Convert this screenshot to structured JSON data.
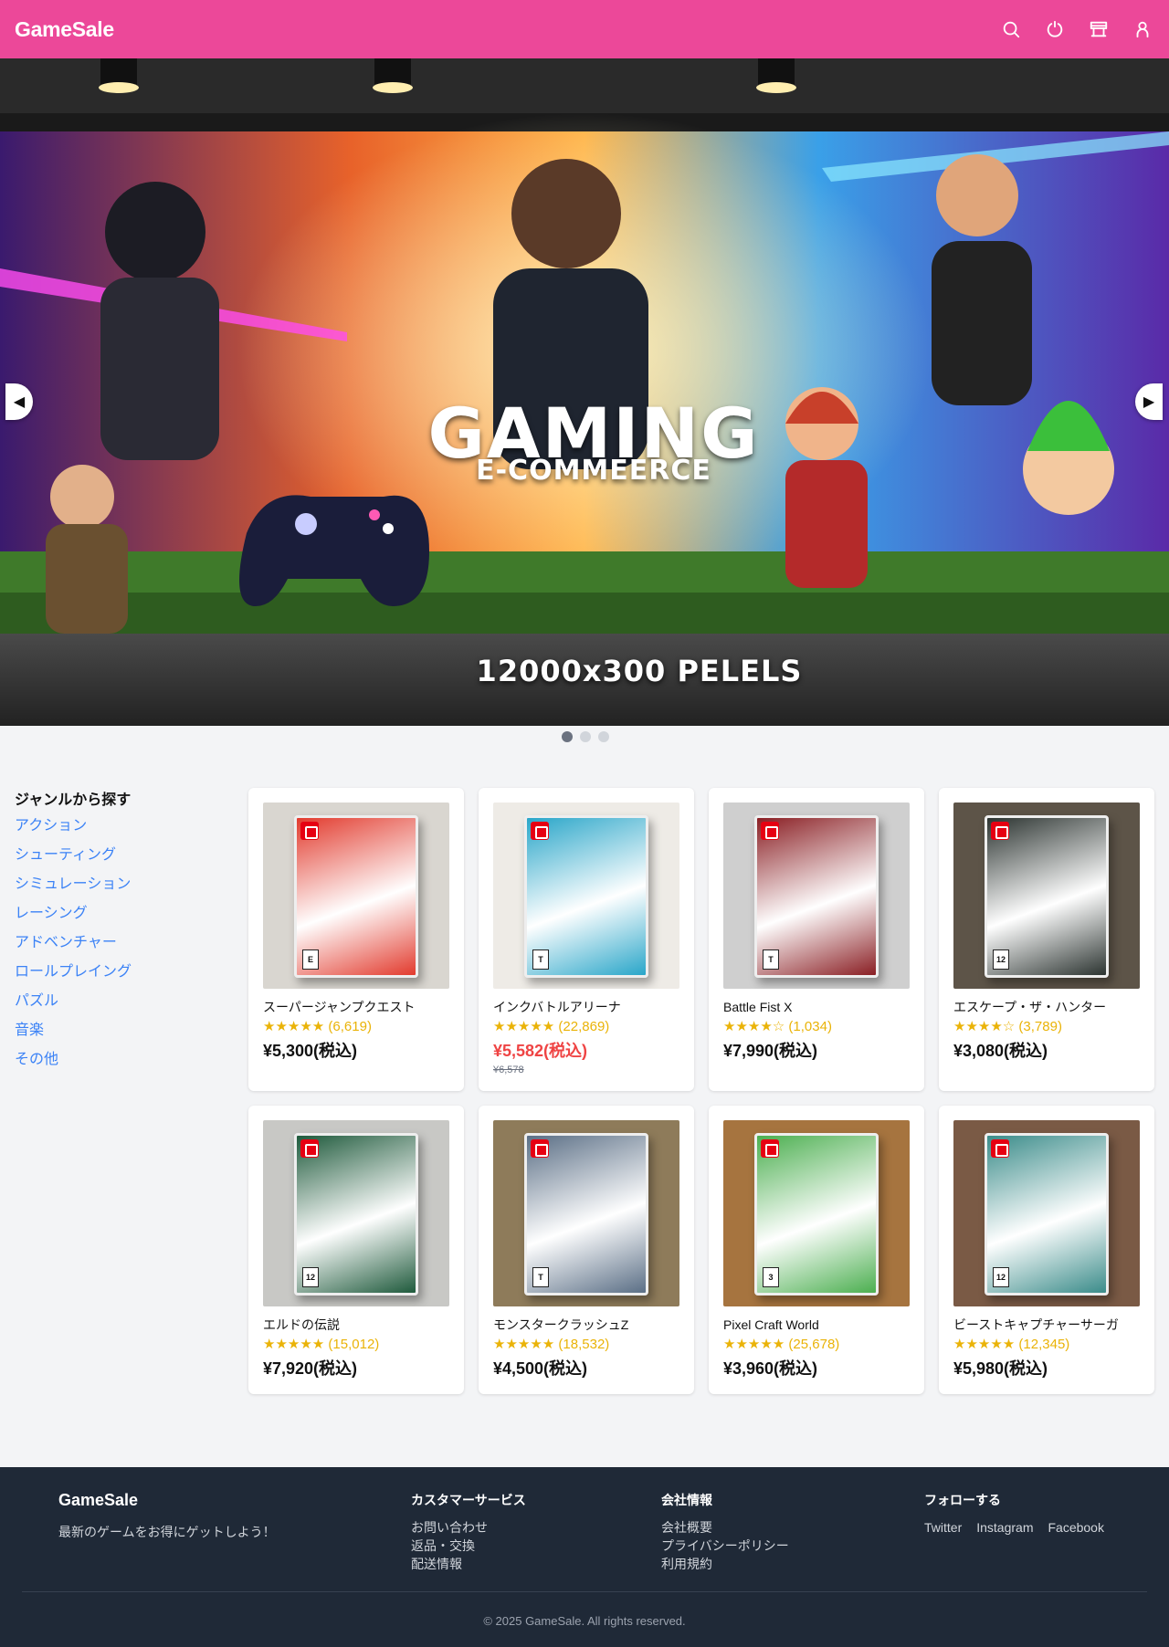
{
  "header": {
    "logo": "GameSale",
    "icons": [
      "search-icon",
      "power-icon",
      "store-icon",
      "user-icon"
    ]
  },
  "hero": {
    "title": "GAMING",
    "subtitle": "E-COMMEERCE",
    "caption": "12000x300 PELELS",
    "prev_label": "◀",
    "next_label": "▶",
    "slides": 3,
    "active_slide": 1
  },
  "sidebar": {
    "title": "ジャンルから探す",
    "genres": [
      "アクション",
      "シューティング",
      "シミュレーション",
      "レーシング",
      "アドベンチャー",
      "ロールプレイング",
      "パズル",
      "音楽",
      "その他"
    ]
  },
  "products": [
    {
      "name": "スーパージャンプクエスト",
      "stars": "★★★★★",
      "reviews": "(6,619)",
      "price": "¥5,300(税込)",
      "old_price": "",
      "bg": "#d9d6d0",
      "art": "#e23b2e",
      "rating_badge": "E"
    },
    {
      "name": "インクバトルアリーナ",
      "stars": "★★★★★",
      "reviews": "(22,869)",
      "price": "¥5,582(税込)",
      "old_price": "¥6,578",
      "bg": "#eeebe6",
      "art": "#2aa6c9",
      "rating_badge": "T"
    },
    {
      "name": "Battle Fist X",
      "stars": "★★★★☆",
      "reviews": "(1,034)",
      "price": "¥7,990(税込)",
      "old_price": "",
      "bg": "#cfcfcf",
      "art": "#8a1f24",
      "rating_badge": "T"
    },
    {
      "name": "エスケープ・ザ・ハンター",
      "stars": "★★★★☆",
      "reviews": "(3,789)",
      "price": "¥3,080(税込)",
      "old_price": "",
      "bg": "#5d5448",
      "art": "#2c3431",
      "rating_badge": "12"
    },
    {
      "name": "エルドの伝説",
      "stars": "★★★★★",
      "reviews": "(15,012)",
      "price": "¥7,920(税込)",
      "old_price": "",
      "bg": "#c8c8c5",
      "art": "#1f5a3c",
      "rating_badge": "12"
    },
    {
      "name": "モンスタークラッシュZ",
      "stars": "★★★★★",
      "reviews": "(18,532)",
      "price": "¥4,500(税込)",
      "old_price": "",
      "bg": "#8e7b5a",
      "art": "#5b6f86",
      "rating_badge": "T"
    },
    {
      "name": "Pixel Craft World",
      "stars": "★★★★★",
      "reviews": "(25,678)",
      "price": "¥3,960(税込)",
      "old_price": "",
      "bg": "#a6743f",
      "art": "#4caf50",
      "rating_badge": "3"
    },
    {
      "name": "ビーストキャプチャーサーガ",
      "stars": "★★★★★",
      "reviews": "(12,345)",
      "price": "¥5,980(税込)",
      "old_price": "",
      "bg": "#7a5a45",
      "art": "#3b8c8a",
      "rating_badge": "12"
    }
  ],
  "footer": {
    "brand": "GameSale",
    "tagline": "最新のゲームをお得にゲットしよう！",
    "customer_service": {
      "title": "カスタマーサービス",
      "links": [
        "お問い合わせ",
        "返品・交換",
        "配送情報"
      ]
    },
    "company": {
      "title": "会社情報",
      "links": [
        "会社概要",
        "プライバシーポリシー",
        "利用規約"
      ]
    },
    "follow": {
      "title": "フォローする",
      "links": [
        "Twitter",
        "Instagram",
        "Facebook"
      ]
    },
    "copyright": "© 2025 GameSale. All rights reserved."
  },
  "colors": {
    "brand": "#ec4899",
    "link": "#3b82f6",
    "star": "#eab308",
    "sale": "#ef4444",
    "footer_bg": "#1f2937"
  }
}
